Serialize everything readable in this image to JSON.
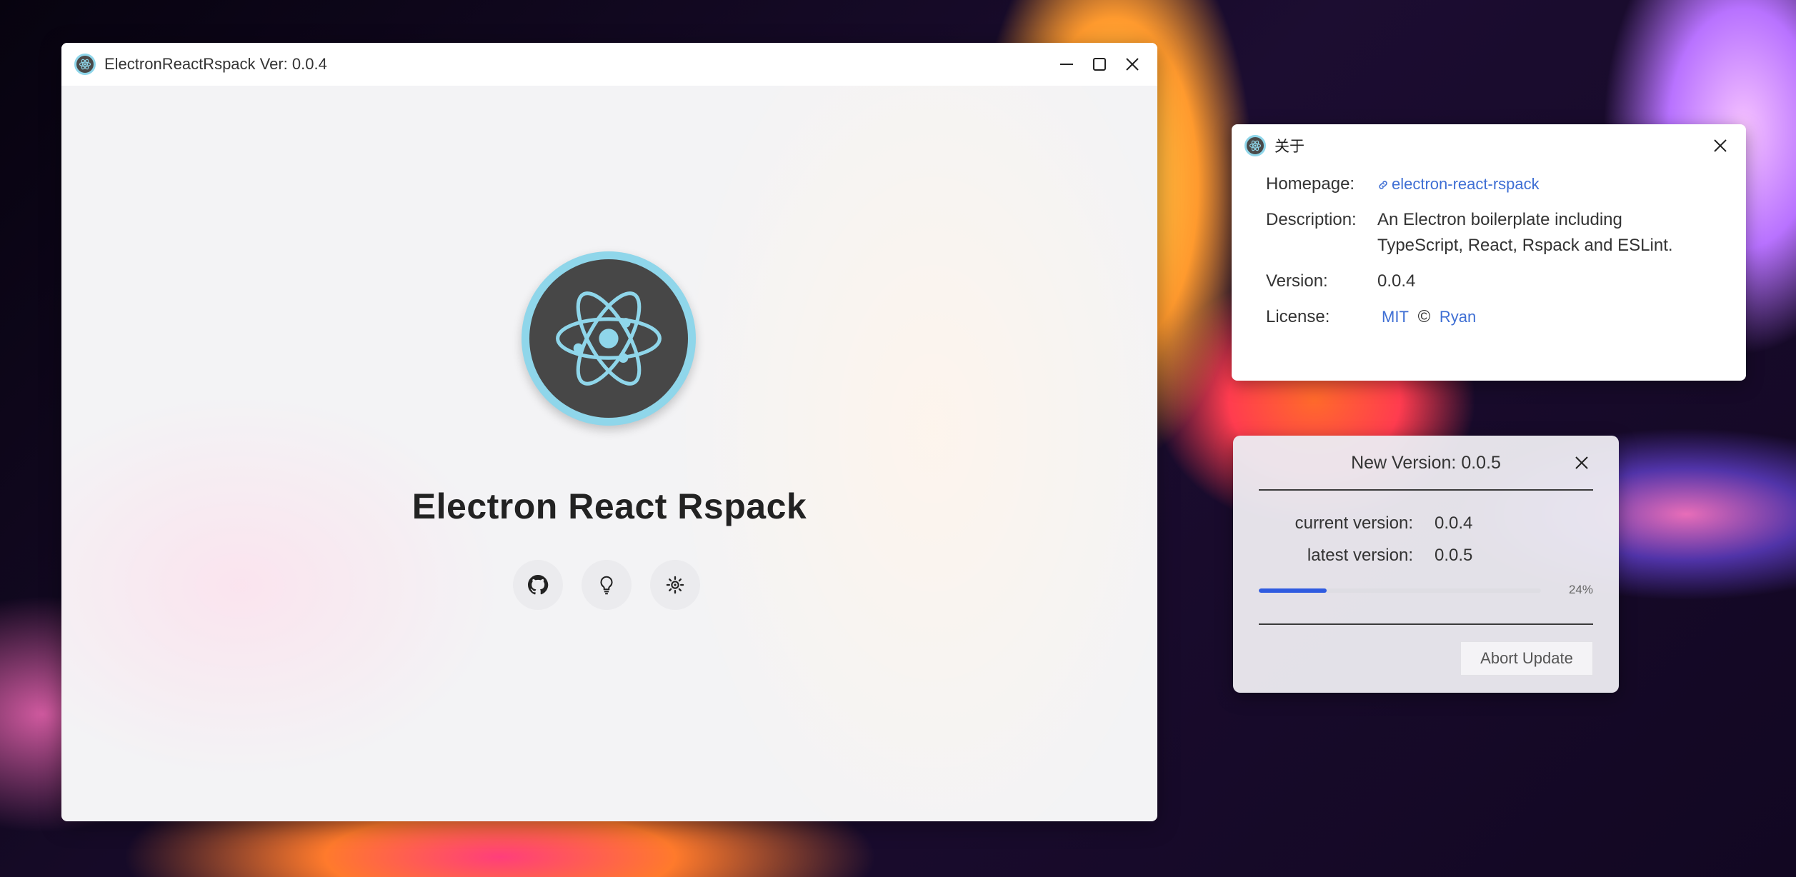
{
  "main_window": {
    "title": "ElectronReactRspack Ver: 0.0.4",
    "app_name": "Electron React Rspack",
    "buttons": [
      {
        "icon": "github-icon"
      },
      {
        "icon": "lightbulb-icon"
      },
      {
        "icon": "settings-icon"
      }
    ]
  },
  "about_dialog": {
    "title": "关于",
    "homepage_label": "Homepage:",
    "homepage_link": "electron-react-rspack",
    "description_label": "Description:",
    "description_line1": "An Electron boilerplate including",
    "description_line2": "TypeScript, React, Rspack and ESLint.",
    "version_label": "Version:",
    "version_value": "0.0.4",
    "license_label": "License:",
    "license_link": "MIT",
    "copyright_symbol": "©",
    "author_link": "Ryan"
  },
  "update_dialog": {
    "title": "New Version: 0.0.5",
    "current_label": "current version:",
    "current_value": "0.0.4",
    "latest_label": "latest version:",
    "latest_value": "0.0.5",
    "progress_percent": 24,
    "progress_text": "24%",
    "abort_label": "Abort Update"
  },
  "colors": {
    "accent": "#2f5be0",
    "link": "#3f6fd4",
    "logo_ring": "#8fd6ea",
    "logo_body": "#474747"
  }
}
